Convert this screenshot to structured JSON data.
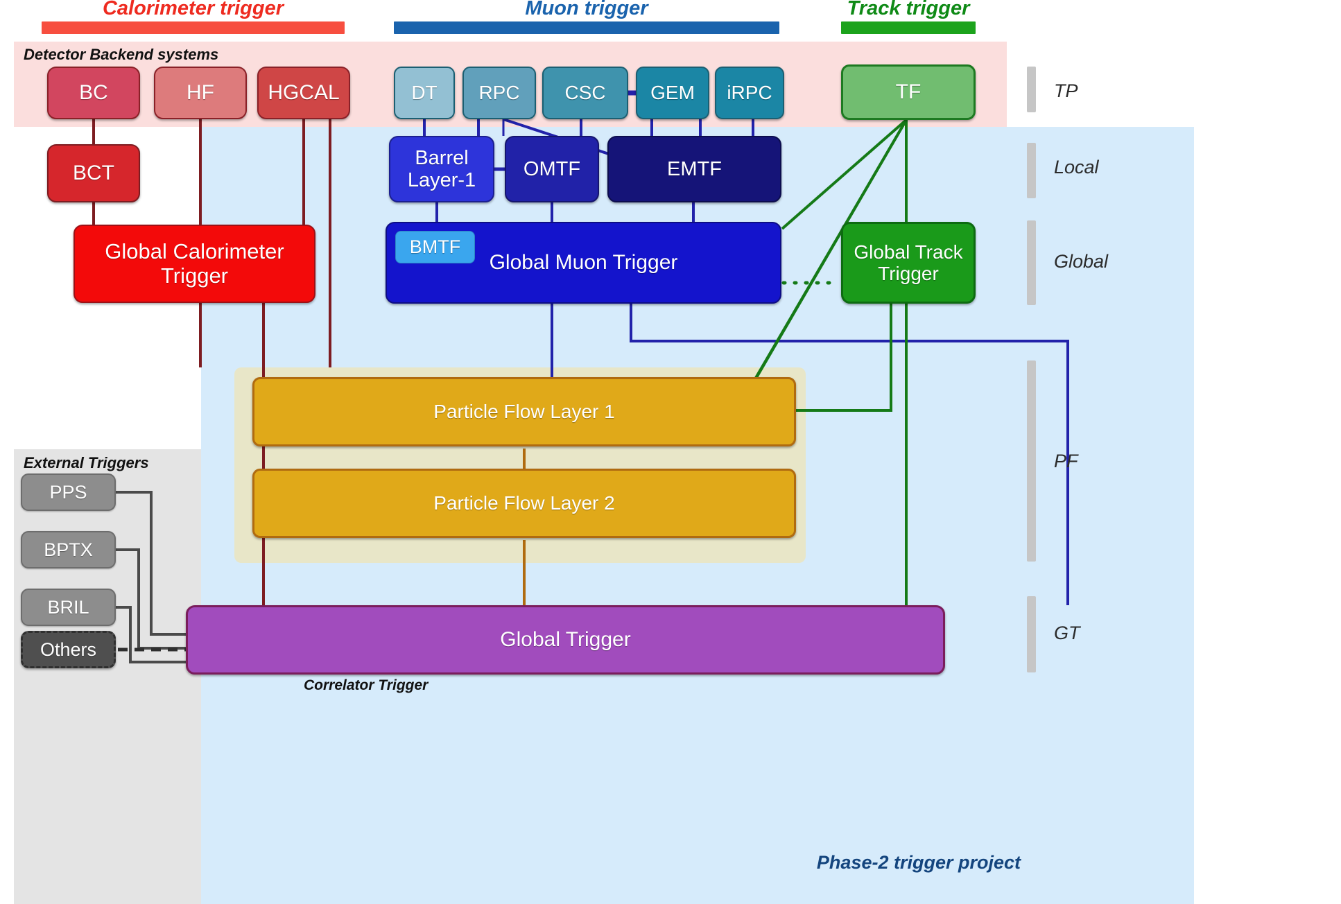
{
  "categories": [
    {
      "id": "calorimeter",
      "label": "Calorimeter trigger",
      "color": "#ee2b20",
      "bar_color": "#f74e3f"
    },
    {
      "id": "muon",
      "label": "Muon trigger",
      "color": "#1a63ad",
      "bar_color": "#1a63ad"
    },
    {
      "id": "track",
      "label": "Track trigger",
      "color": "#0f8a16",
      "bar_color": "#1ca31c"
    }
  ],
  "bands": {
    "backend_caption": "Detector Backend systems",
    "external_caption": "External Triggers",
    "correlator_caption": "Correlator Trigger",
    "project_caption": "Phase-2 trigger project",
    "backend_color": "#fbdedd",
    "project_color": "#d6ebfb",
    "external_color": "#e4e4e4",
    "correlator_color": "#e8e6c8"
  },
  "nodes": {
    "bc": {
      "label": "BC",
      "color": "#d2465f"
    },
    "hf": {
      "label": "HF",
      "color": "#dd7b7c"
    },
    "hgcal": {
      "label": "HGCAL",
      "color": "#cf4646"
    },
    "bct": {
      "label": "BCT",
      "color": "#d6262c"
    },
    "gct": {
      "label": "Global Calorimeter Trigger",
      "color": "#f30a0a"
    },
    "dt": {
      "label": "DT",
      "color": "#93c0d3"
    },
    "rpc": {
      "label": "RPC",
      "color": "#61a0bb"
    },
    "csc": {
      "label": "CSC",
      "color": "#3f93ad"
    },
    "gem": {
      "label": "GEM",
      "color": "#1b86a5"
    },
    "irpc": {
      "label": "iRPC",
      "color": "#1b86a5"
    },
    "barrel": {
      "label": "Barrel Layer-1",
      "color": "#2d34da"
    },
    "omtf": {
      "label": "OMTF",
      "color": "#2122a8"
    },
    "emtf": {
      "label": "EMTF",
      "color": "#151478"
    },
    "bmtf": {
      "label": "BMTF",
      "color": "#3aa6ee"
    },
    "gmt": {
      "label": "Global Muon Trigger",
      "color": "#1414cc"
    },
    "tf": {
      "label": "TF",
      "color": "#71bd70"
    },
    "gtt": {
      "label": "Global Track Trigger",
      "color": "#1a9a1a"
    },
    "pf1": {
      "label": "Particle Flow Layer 1",
      "color": "#e0a919"
    },
    "pf2": {
      "label": "Particle Flow Layer 2",
      "color": "#e0a919"
    },
    "pps": {
      "label": "PPS",
      "color": "#8d8d8d"
    },
    "bptx": {
      "label": "BPTX",
      "color": "#8d8d8d"
    },
    "bril": {
      "label": "BRIL",
      "color": "#8d8d8d"
    },
    "others": {
      "label": "Others",
      "color": "#4f4f4f"
    },
    "gt": {
      "label": "Global Trigger",
      "color": "#a14cbd"
    }
  },
  "stages": [
    {
      "id": "tp",
      "label": "TP"
    },
    {
      "id": "local",
      "label": "Local"
    },
    {
      "id": "global",
      "label": "Global"
    },
    {
      "id": "pf",
      "label": "PF"
    },
    {
      "id": "gt",
      "label": "GT"
    }
  ],
  "wire_colors": {
    "calorimeter": "#7d1c21",
    "muon": "#2222aa",
    "track": "#157a17",
    "external": "#4a4a4a",
    "correlator": "#b06b10"
  }
}
